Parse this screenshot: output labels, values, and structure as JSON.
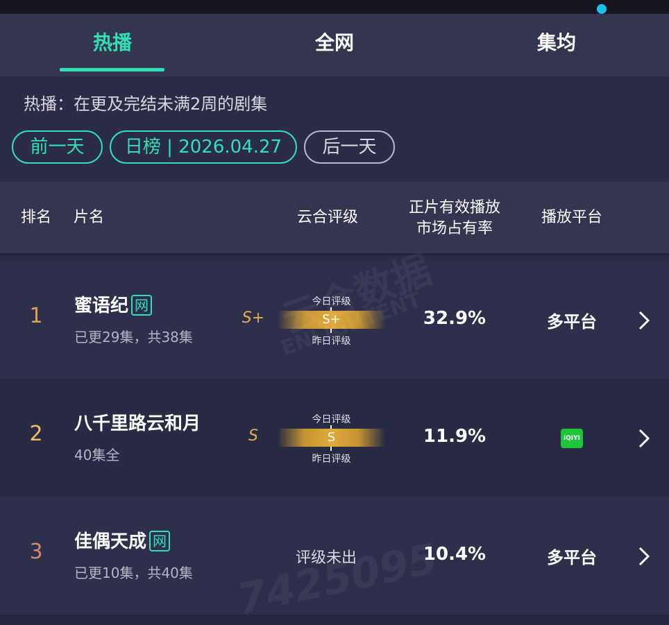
{
  "tabs": [
    {
      "label": "热播",
      "active": true
    },
    {
      "label": "全网",
      "active": false
    },
    {
      "label": "集均",
      "active": false
    }
  ],
  "description": "热播：在更及完结未满2周的剧集",
  "date_nav": {
    "prev": "前一天",
    "current": "日榜 | 2026.04.27",
    "next": "后一天"
  },
  "table": {
    "headers": {
      "rank": "排名",
      "title": "片名",
      "grade": "云合评级",
      "share_line1": "正片有效播放",
      "share_line2": "市场占有率",
      "platform": "播放平台"
    },
    "grade_labels": {
      "today": "今日评级",
      "yesterday": "昨日评级"
    },
    "rows": [
      {
        "rank": "1",
        "title": "蜜语纪",
        "badge": "网",
        "subtitle": "已更29集，共38集",
        "grade": "S+",
        "share": "32.9%",
        "platform": "多平台"
      },
      {
        "rank": "2",
        "title": "八千里路云和月",
        "badge": "",
        "subtitle": "40集全",
        "grade": "S",
        "share": "11.9%",
        "platform": "iQIYI"
      },
      {
        "rank": "3",
        "title": "佳偶天成",
        "badge": "网",
        "subtitle": "已更10集，共40集",
        "grade": "评级未出",
        "share": "10.4%",
        "platform": "多平台"
      }
    ]
  },
  "colors": {
    "accent": "#31e0b5",
    "rank1": "#e0a050",
    "rank2": "#f0c060",
    "rank3": "#d08a70",
    "grade_gold": "#e0aa3a",
    "iqiyi_green": "#1fc43a"
  },
  "watermark": {
    "logo": "云合数据",
    "logo_en": "ENLIGHTENT",
    "id": "7425095"
  }
}
